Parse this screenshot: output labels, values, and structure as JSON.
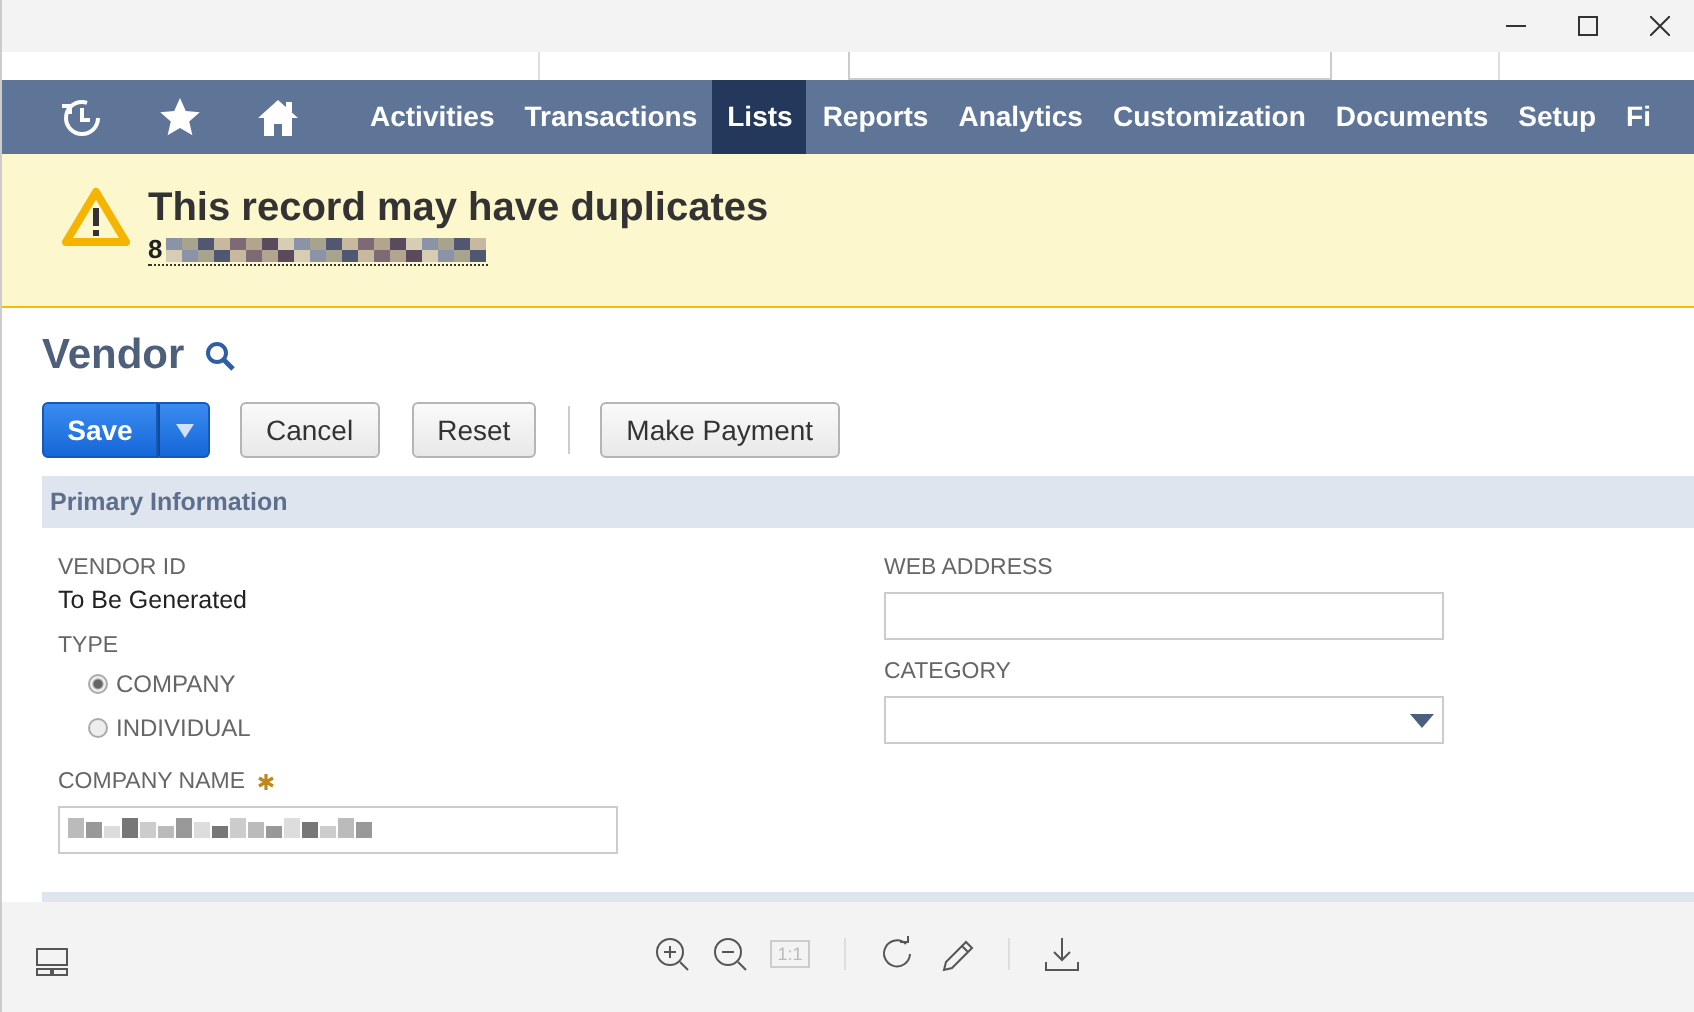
{
  "nav": {
    "items": [
      {
        "label": "Activities",
        "selected": false
      },
      {
        "label": "Transactions",
        "selected": false
      },
      {
        "label": "Lists",
        "selected": true
      },
      {
        "label": "Reports",
        "selected": false
      },
      {
        "label": "Analytics",
        "selected": false
      },
      {
        "label": "Customization",
        "selected": false
      },
      {
        "label": "Documents",
        "selected": false
      },
      {
        "label": "Setup",
        "selected": false
      },
      {
        "label": "Fi",
        "selected": false
      }
    ]
  },
  "alert": {
    "title": "This record may have duplicates",
    "link": "8"
  },
  "record": {
    "title": "Vendor",
    "buttons": [
      {
        "label": "Save",
        "kind": "primary"
      },
      {
        "label": "Cancel",
        "kind": "plain"
      },
      {
        "label": "Reset",
        "kind": "plain"
      },
      {
        "label": "Make Payment",
        "kind": "plain"
      }
    ]
  },
  "section": {
    "title": "Primary Information"
  },
  "left_fields": [
    {
      "kind": "static",
      "label": "VENDOR ID",
      "value": "To Be Generated"
    },
    {
      "kind": "radio",
      "label": "TYPE",
      "options": [
        {
          "label": "COMPANY",
          "selected": true
        },
        {
          "label": "INDIVIDUAL",
          "selected": false
        }
      ]
    },
    {
      "kind": "text",
      "label": "COMPANY NAME",
      "required": true
    }
  ],
  "right_fields": [
    {
      "kind": "text",
      "label": "WEB ADDRESS",
      "required": false
    },
    {
      "kind": "select",
      "label": "CATEGORY",
      "required": false
    }
  ],
  "viewer": {
    "tools": [
      {
        "kind": "zoomin",
        "disabled": false
      },
      {
        "kind": "zoomout",
        "disabled": false
      },
      {
        "kind": "actual",
        "text": "1:1",
        "disabled": true
      },
      {
        "kind": "separator"
      },
      {
        "kind": "rotate",
        "disabled": false
      },
      {
        "kind": "pencil",
        "disabled": false
      },
      {
        "kind": "separator"
      },
      {
        "kind": "download",
        "disabled": false
      }
    ]
  }
}
